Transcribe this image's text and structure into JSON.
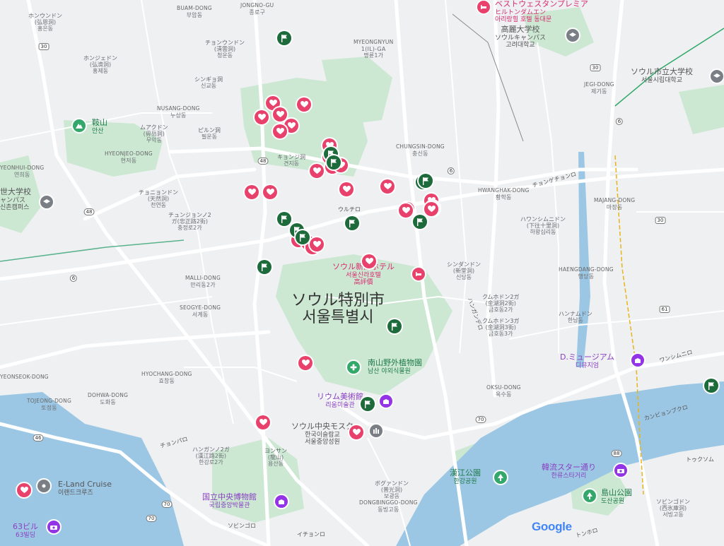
{
  "map": {
    "attribution": "Google",
    "city_label": {
      "ja": "ソウル特別市",
      "ko": "서울특별시"
    },
    "colors": {
      "water": "#9cc7e4",
      "park": "#cce8d3",
      "road": "#ffffff",
      "heart_marker": "#e8416b",
      "flag_marker": "#1d6a3b",
      "purple_poi": "#9334e6"
    },
    "area_labels": [
      {
        "id": "honundon",
        "ja": "ホンウンドン",
        "ko": "(弘恩洞)",
        "ko2": "홍은동"
      },
      {
        "id": "buam",
        "ja": "BUAM-DONG",
        "ko": "부암동"
      },
      {
        "id": "jongno_gu",
        "ja": "JONGNO-GU",
        "ko": "종로구"
      },
      {
        "id": "chongundong",
        "ja": "チョンウンドン",
        "ko": "(淸雲洞)",
        "ko2": "청운동"
      },
      {
        "id": "myeongnyun",
        "ja": "MYEONGNYUN",
        "ko": "1(IL)-GA",
        "ko2": "명륜1가"
      },
      {
        "id": "honjedong",
        "ja": "ホンジェドン",
        "ko": "(弘濟洞)",
        "ko2": "홍제동"
      },
      {
        "id": "sinkyo",
        "ja": "シンギョ洞",
        "ko": "신교동"
      },
      {
        "id": "nusang",
        "ja": "NUSANG-DONG",
        "ko": "누상동"
      },
      {
        "id": "muakdong",
        "ja": "ムアクドン",
        "ko": "(毋岳洞)",
        "ko2": "무악동"
      },
      {
        "id": "pirundong",
        "ja": "ピルン洞",
        "ko": "필운동"
      },
      {
        "id": "hyeonjeo",
        "ja": "HYEONJEO-DONG",
        "ko": "현저동"
      },
      {
        "id": "kyonji",
        "ja": "キョンジ洞",
        "ko": "견지동"
      },
      {
        "id": "chunghyeon",
        "ja": "チョニョンドン",
        "ko": "(天然洞)",
        "ko2": "천연동"
      },
      {
        "id": "chungjeongro",
        "ja": "チュンジョンノ2",
        "ko": "ガ(忠正路2街)",
        "ko2": "충정로2가"
      },
      {
        "id": "malli",
        "ja": "MALLI-DONG",
        "ko": "만리동2가"
      },
      {
        "id": "seogye",
        "ja": "SEOGYE-DONG",
        "ko": "서계동"
      },
      {
        "id": "hyochang",
        "ja": "HYOCHANG-DONG",
        "ko": "효창동"
      },
      {
        "id": "dohwa",
        "ja": "DOHWA-DONG",
        "ko": "도화동"
      },
      {
        "id": "tojeong",
        "ja": "TOJEONG-DONG",
        "ko": "토정동"
      },
      {
        "id": "yongsan",
        "ja": "ヨンサン",
        "ko": "(龍山)",
        "ko2": "용산동"
      },
      {
        "id": "itaewon",
        "ja": "ハンナムドン",
        "ko": "한남동"
      },
      {
        "id": "oksu",
        "ja": "OKSU-DONG",
        "ko": "옥수동"
      },
      {
        "id": "haengdang",
        "ja": "HAENGDANG-DONG",
        "ko": "행당동"
      },
      {
        "id": "majang",
        "ja": "MAJANG-DONG",
        "ko": "마장동"
      },
      {
        "id": "hwanghak",
        "ja": "HWANGHAK-DONG",
        "ko": "황학동"
      },
      {
        "id": "jegi",
        "ja": "JEGI-DONG",
        "ko": "제기동"
      },
      {
        "id": "chungsin",
        "ja": "CHUNGSIN-DONG",
        "ko": "충신동"
      },
      {
        "id": "yeonhui",
        "ja": "YEONHUI-DONG",
        "ko": "연희동"
      },
      {
        "id": "dongbinggo",
        "ja": "DONGBINGGO-DONG",
        "ko": "동빙고동"
      },
      {
        "id": "sindang",
        "ja": "シンダンドン",
        "ko": "(新堂洞)",
        "ko2": "신당동"
      },
      {
        "id": "geumho",
        "ja": "クムホドン2ガ",
        "ko": "(金湖洞2街)",
        "ko2": "금호동2가"
      },
      {
        "id": "geumho3",
        "ja": "クムホドン3ガ",
        "ko": "(金湖洞3街)",
        "ko2": "금호동3가"
      },
      {
        "id": "wangsimni",
        "ja": "ハワンシムニドン",
        "ko": "(下往十里洞)",
        "ko2": "하왕십리동"
      },
      {
        "id": "yeonseok",
        "ja": "YEONSEOK-DONG",
        "ko": ""
      },
      {
        "id": "bogwang",
        "ja": "ボグァンドン",
        "ko": "(普光洞)",
        "ko2": "보광동"
      },
      {
        "id": "hannam",
        "ja": "ハンガンノ2ガ",
        "ko": "(漢江路2街)",
        "ko2": "한강로2가"
      },
      {
        "id": "seobinggo",
        "ja": "ソビンゴドン",
        "ko": "(西氷庫洞)",
        "ko2": "서빙고동"
      }
    ],
    "pois": [
      {
        "id": "namsan_botanical",
        "ja": "南山野外植物園",
        "ko": "남산 야외식물원",
        "kind": "green"
      },
      {
        "id": "hotel_shilla",
        "ja": "ソウル新羅ホテル",
        "ko": "서울신라호텔",
        "ko2": "高評價",
        "kind": "pink"
      },
      {
        "id": "leeum",
        "ja": "リウム美術館",
        "ko": "리움미술관",
        "kind": "purple"
      },
      {
        "id": "national_museum",
        "ja": "国立中央博物館",
        "ko": "국립중앙박물관",
        "kind": "purple"
      },
      {
        "id": "seoul_central_mosque",
        "ja": "ソウル中央モスク",
        "ko": "한국이슬람교",
        "ko2": "서울중앙성원",
        "kind": "gray"
      },
      {
        "id": "d_museum",
        "ja": "D.ミュージアム",
        "ko": "디뮤지엄",
        "kind": "purple"
      },
      {
        "id": "hallyu_street",
        "ja": "韓流スター通り",
        "ko": "한류스타거리",
        "kind": "purple"
      },
      {
        "id": "hangang_park",
        "ja": "漢江公園",
        "ko": "한강공원",
        "kind": "green"
      },
      {
        "id": "dosan_park",
        "ja": "島山公園",
        "ko": "도산공원",
        "kind": "green"
      },
      {
        "id": "eland_cruise",
        "ja": "E-Land Cruise",
        "ko": "이랜드크루즈",
        "kind": "gray"
      },
      {
        "id": "building_63",
        "ja": "63ビル",
        "ko": "63빌딩",
        "kind": "purple"
      },
      {
        "id": "korea_univ",
        "ja": "高麗大学校",
        "ko": "ソウルキャンパス",
        "ko2": "고려대학교",
        "kind": "gray"
      },
      {
        "id": "city_univ",
        "ja": "ソウル市立大学校",
        "ko": "서울시립대학교",
        "kind": "gray"
      },
      {
        "id": "yonsei",
        "ja": "世大学校",
        "ko": "ャンパス",
        "ko2": "신촌캠퍼스",
        "kind": "gray"
      },
      {
        "id": "ansan",
        "ja": "鞍山",
        "ko": "안산",
        "kind": "green"
      },
      {
        "id": "hotel_top",
        "ja": "ベストウェスタンプレミア",
        "ko": "ヒルトンダムエン",
        "ko2": "아리랑힐 호텔 동대문",
        "kind": "pink"
      }
    ],
    "roads": [
      {
        "id": "ulchiro",
        "label": "ウルチロ"
      },
      {
        "id": "chongyecheon",
        "label": "チョンゲチョンロ"
      },
      {
        "id": "chonpaaro",
        "label": "チョンパロ"
      },
      {
        "id": "sobingoro",
        "label": "ソビンゴロ"
      },
      {
        "id": "togsu",
        "label": "トゥクソム"
      },
      {
        "id": "wangsimni_ro",
        "label": "ワンシムニロ"
      },
      {
        "id": "hangang_daero",
        "label": "ハンガンデロ"
      },
      {
        "id": "dongho",
        "label": "トンホロ"
      },
      {
        "id": "ichonro",
        "label": "イチョンロ"
      },
      {
        "id": "gangbyeon",
        "label": "カンビョンブクロ"
      }
    ],
    "route_shields": [
      "30",
      "48",
      "48",
      "6",
      "6",
      "30",
      "46",
      "70",
      "70",
      "88",
      "61",
      "30",
      "6",
      "70"
    ],
    "heart_markers": 30,
    "flag_markers": 14
  }
}
